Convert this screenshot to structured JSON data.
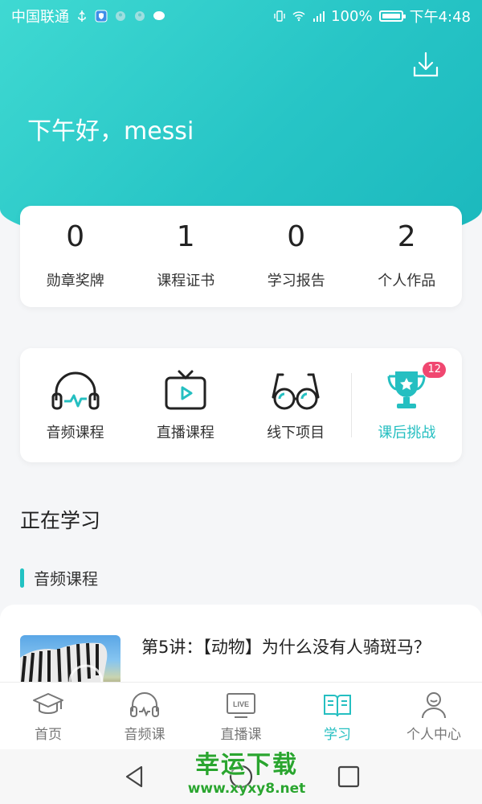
{
  "status_bar": {
    "carrier": "中国联通",
    "battery": "100%",
    "time": "下午4:48"
  },
  "header": {
    "greeting": "下午好，messi"
  },
  "stats": [
    {
      "value": "0",
      "label": "勋章奖牌"
    },
    {
      "value": "1",
      "label": "课程证书"
    },
    {
      "value": "0",
      "label": "学习报告"
    },
    {
      "value": "2",
      "label": "个人作品"
    }
  ],
  "quick_links": [
    {
      "label": "音频课程",
      "icon": "headphones-icon"
    },
    {
      "label": "直播课程",
      "icon": "tv-icon"
    },
    {
      "label": "线下项目",
      "icon": "glasses-icon"
    },
    {
      "label": "课后挑战",
      "icon": "trophy-icon",
      "badge": "12"
    }
  ],
  "learning": {
    "title": "正在学习",
    "category": "音频课程",
    "course_title": "第5讲：【动物】为什么没有人骑斑马？"
  },
  "tabs": [
    {
      "label": "首页",
      "icon": "graduation-cap-icon"
    },
    {
      "label": "音频课",
      "icon": "headphones-icon"
    },
    {
      "label": "直播课",
      "icon": "live-tv-icon"
    },
    {
      "label": "学习",
      "icon": "book-icon",
      "active": true
    },
    {
      "label": "个人中心",
      "icon": "person-icon"
    }
  ],
  "watermark": {
    "line1": "幸运下载",
    "line2": "www.xyxy8.net"
  },
  "colors": {
    "accent": "#25bfc1",
    "badge": "#f04770"
  }
}
